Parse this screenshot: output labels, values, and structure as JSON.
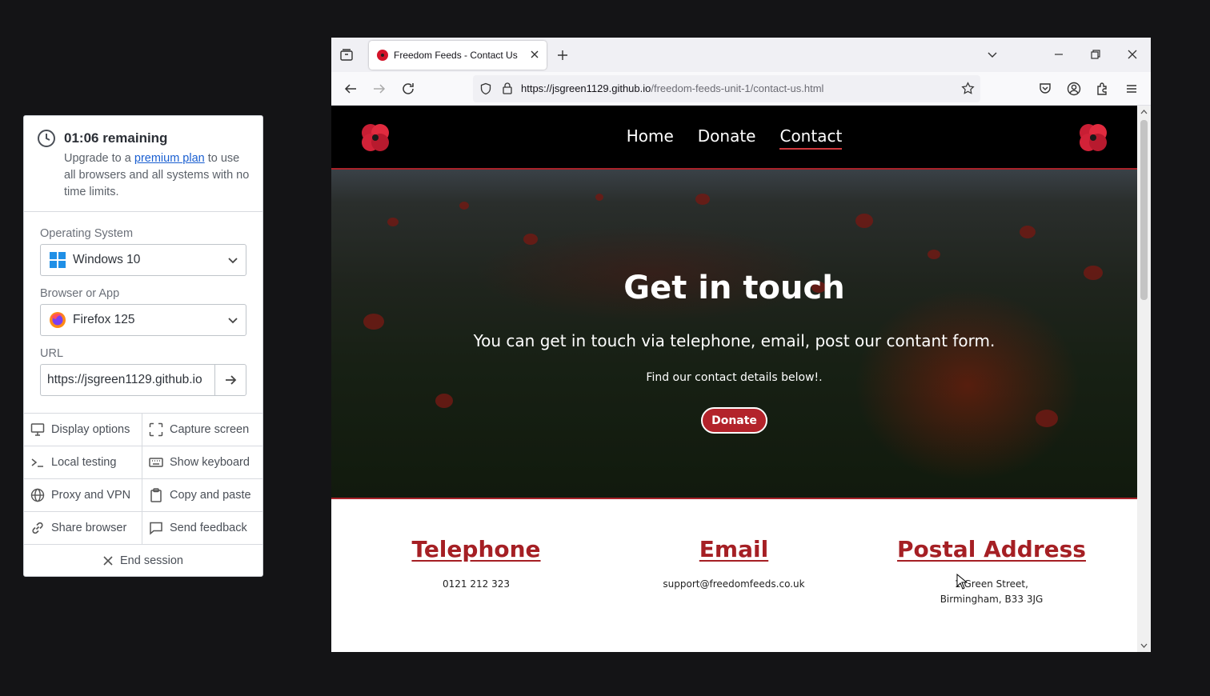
{
  "session_panel": {
    "timer_title": "01:06 remaining",
    "upgrade_before": "Upgrade to a ",
    "upgrade_link": "premium plan",
    "upgrade_after": " to use all browsers and all systems with no time limits.",
    "os_label": "Operating System",
    "os_value": "Windows 10",
    "browser_label": "Browser or App",
    "browser_value": "Firefox 125",
    "url_label": "URL",
    "url_value": "https://jsgreen1129.github.io",
    "actions": {
      "display_options": "Display options",
      "capture_screen": "Capture screen",
      "local_testing": "Local testing",
      "show_keyboard": "Show keyboard",
      "proxy_vpn": "Proxy and VPN",
      "copy_paste": "Copy and paste",
      "share_browser": "Share browser",
      "send_feedback": "Send feedback"
    },
    "end_session": "End session"
  },
  "browser": {
    "tab_title": "Freedom Feeds - Contact Us",
    "url_host": "https://jsgreen1129.github.io",
    "url_path": "/freedom-feeds-unit-1/contact-us.html"
  },
  "site": {
    "nav": {
      "home": "Home",
      "donate": "Donate",
      "contact": "Contact"
    },
    "hero": {
      "title": "Get in touch",
      "lead": "You can get in touch via telephone, email, post our contant form.",
      "sub": "Find our contact details below!.",
      "button": "Donate"
    },
    "contacts": {
      "telephone_title": "Telephone",
      "telephone_value": "0121 212 323",
      "email_title": "Email",
      "email_value": "support@freedomfeeds.co.uk",
      "postal_title": "Postal Address",
      "postal_line1": "1 Green Street,",
      "postal_line2": "Birmingham, B33 3JG"
    }
  },
  "colors": {
    "brand_red": "#a51f24",
    "button_red": "#b3232b",
    "link_blue": "#1a5fd1"
  }
}
